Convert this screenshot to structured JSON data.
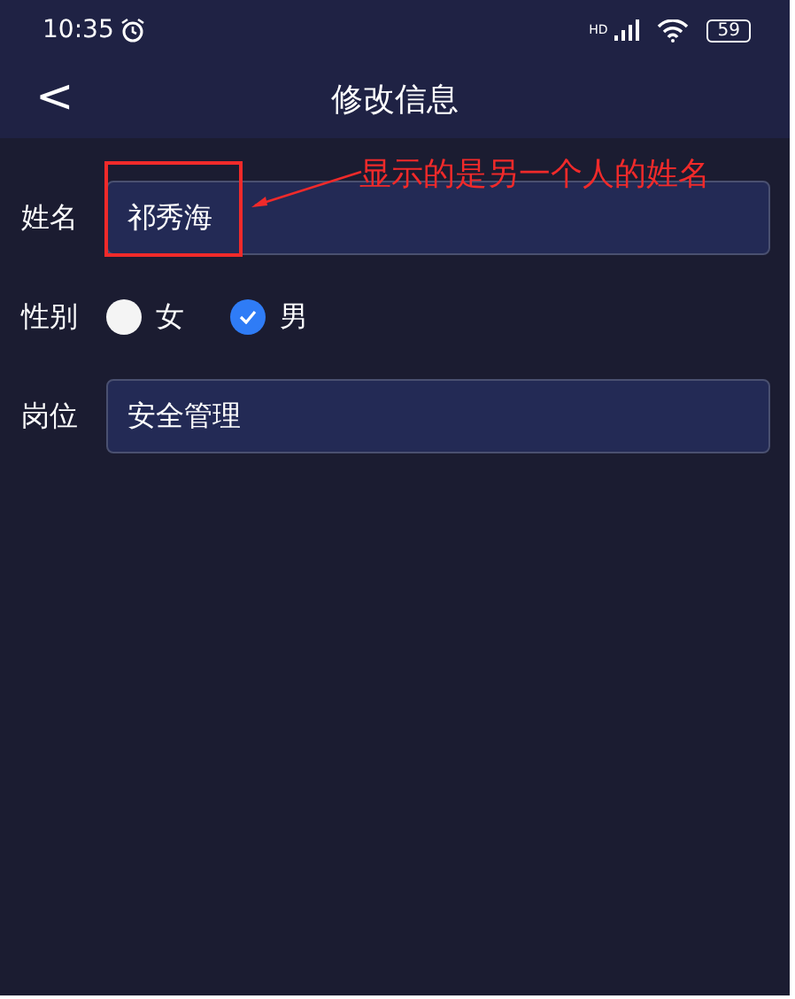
{
  "status_bar": {
    "time": "10:35",
    "network": "HD",
    "battery": "59"
  },
  "header": {
    "back": "<",
    "title": "修改信息"
  },
  "form": [
    {
      "kind": "text",
      "label": "姓名",
      "value": "祁秀海"
    },
    {
      "kind": "radio",
      "label": "性别",
      "options": [
        {
          "label": "女",
          "selected": false
        },
        {
          "label": "男",
          "selected": true
        }
      ]
    },
    {
      "kind": "text",
      "label": "岗位",
      "value": "安全管理"
    }
  ],
  "annotation": {
    "text": "显示的是另一个人的姓名"
  }
}
